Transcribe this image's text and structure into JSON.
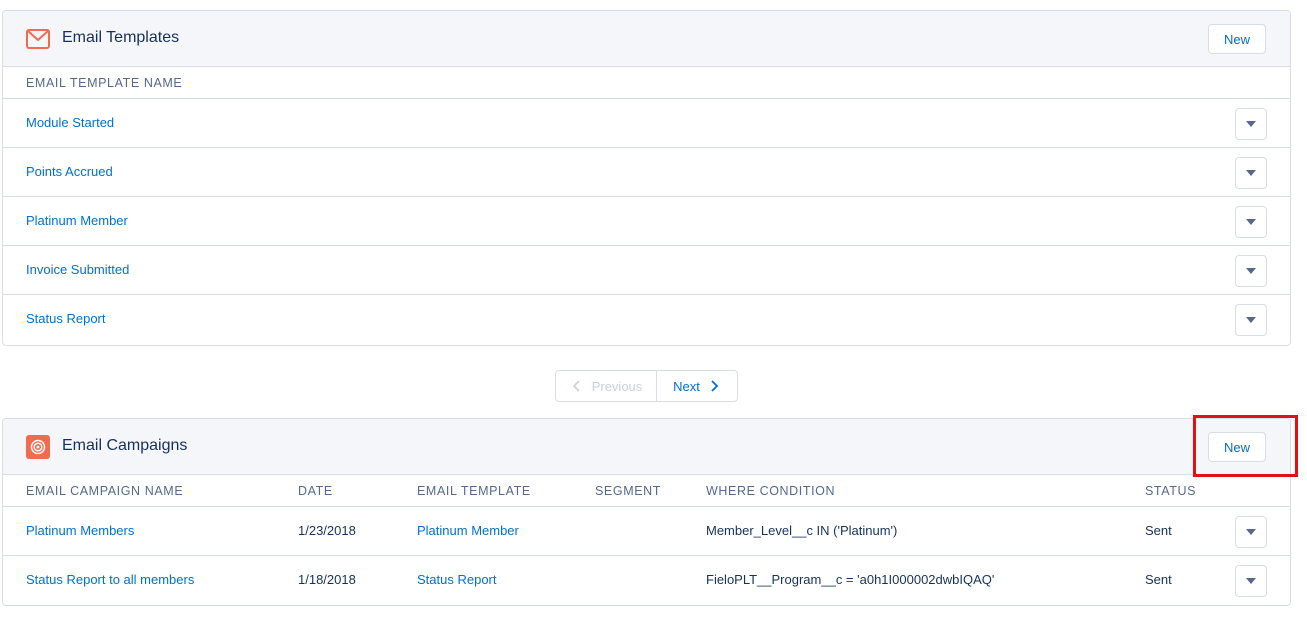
{
  "templates_card": {
    "title": "Email Templates",
    "icon": "envelope-icon",
    "new_label": "New",
    "column_header": "Email Template Name",
    "rows": [
      {
        "name": "Module Started"
      },
      {
        "name": "Points Accrued"
      },
      {
        "name": "Platinum Member"
      },
      {
        "name": "Invoice Submitted"
      },
      {
        "name": "Status Report"
      }
    ]
  },
  "pagination": {
    "previous_label": "Previous",
    "next_label": "Next"
  },
  "campaigns_card": {
    "title": "Email Campaigns",
    "icon": "target-icon",
    "new_label": "New",
    "columns": {
      "name": "Email Campaign Name",
      "date": "Date",
      "template": "Email Template",
      "segment": "Segment",
      "where": "Where Condition",
      "status": "Status"
    },
    "rows": [
      {
        "name": "Platinum Members",
        "date": "1/23/2018",
        "template": "Platinum Member",
        "segment": "",
        "where": "Member_Level__c IN ('Platinum')",
        "status": "Sent"
      },
      {
        "name": "Status Report to all members",
        "date": "1/18/2018",
        "template": "Status Report",
        "segment": "",
        "where": "FieloPLT__Program__c = 'a0h1I000002dwbIQAQ'",
        "status": "Sent"
      }
    ]
  },
  "colors": {
    "link": "#0070d2",
    "icon_bg": "#f26b4f",
    "highlight": "#e3101a"
  }
}
